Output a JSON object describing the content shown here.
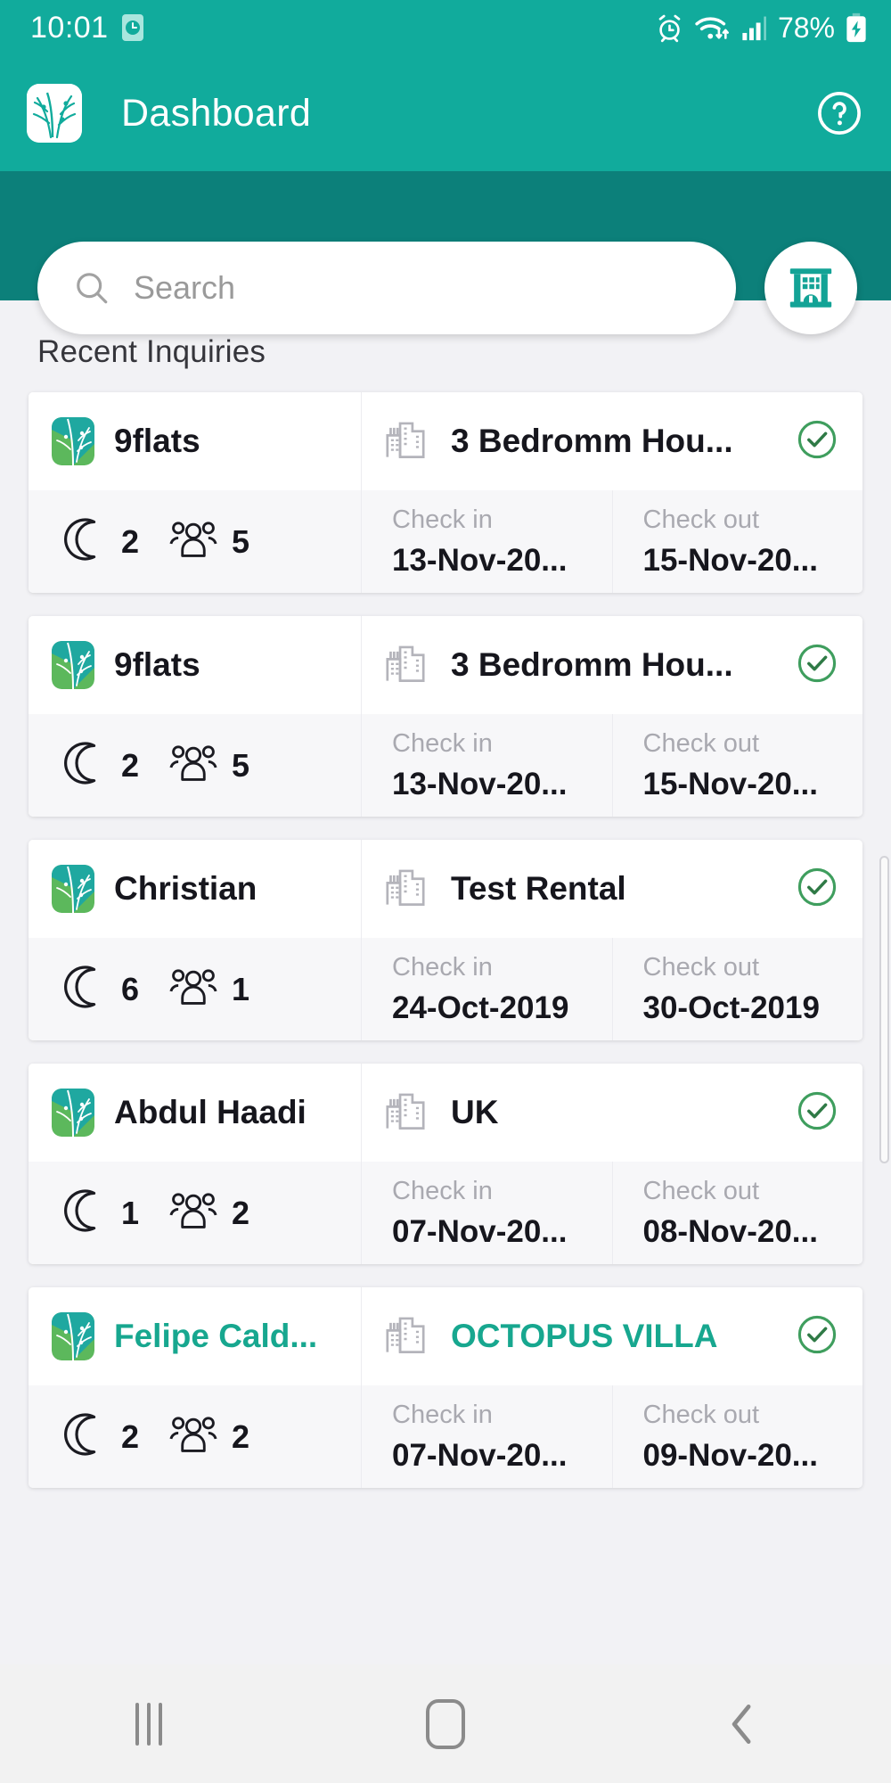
{
  "statusbar": {
    "time": "10:01",
    "battery_percent": "78%",
    "icons": [
      "clock-badge-icon",
      "alarm-icon",
      "wifi-icon",
      "signal-icon",
      "battery-charging-icon"
    ]
  },
  "appbar": {
    "title": "Dashboard",
    "logo": "leaf-logo-icon",
    "help": "help-circle-icon"
  },
  "search": {
    "placeholder": "Search",
    "value": "",
    "icon": "search-icon",
    "property_button": "building-icon"
  },
  "main": {
    "section_title": "Recent Inquiries",
    "labels": {
      "check_in": "Check in",
      "check_out": "Check out"
    },
    "cards": [
      {
        "guest": "9flats",
        "property": "3 Bedromm Hou...",
        "nights": "2",
        "guests": "5",
        "check_in": "13-Nov-20...",
        "check_out": "15-Nov-20...",
        "status": "confirmed",
        "highlight": false
      },
      {
        "guest": "9flats",
        "property": "3 Bedromm Hou...",
        "nights": "2",
        "guests": "5",
        "check_in": "13-Nov-20...",
        "check_out": "15-Nov-20...",
        "status": "confirmed",
        "highlight": false
      },
      {
        "guest": "Christian",
        "property": "Test Rental",
        "nights": "6",
        "guests": "1",
        "check_in": "24-Oct-2019",
        "check_out": "30-Oct-2019",
        "status": "confirmed",
        "highlight": false
      },
      {
        "guest": "Abdul Haadi",
        "property": "UK",
        "nights": "1",
        "guests": "2",
        "check_in": "07-Nov-20...",
        "check_out": "08-Nov-20...",
        "status": "confirmed",
        "highlight": false
      },
      {
        "guest": "Felipe Cald...",
        "property": "OCTOPUS VILLA",
        "nights": "2",
        "guests": "2",
        "check_in": "07-Nov-20...",
        "check_out": "09-Nov-20...",
        "status": "confirmed",
        "highlight": true
      }
    ]
  },
  "navbar": {
    "recents": "recents-icon",
    "home": "home-icon",
    "back": "back-icon"
  },
  "colors": {
    "primary": "#11ab9c",
    "primary_dark": "#0c807a",
    "accent_text": "#17a78f",
    "status_ok": "#3f9e5e",
    "page_bg": "#f2f2f5"
  }
}
